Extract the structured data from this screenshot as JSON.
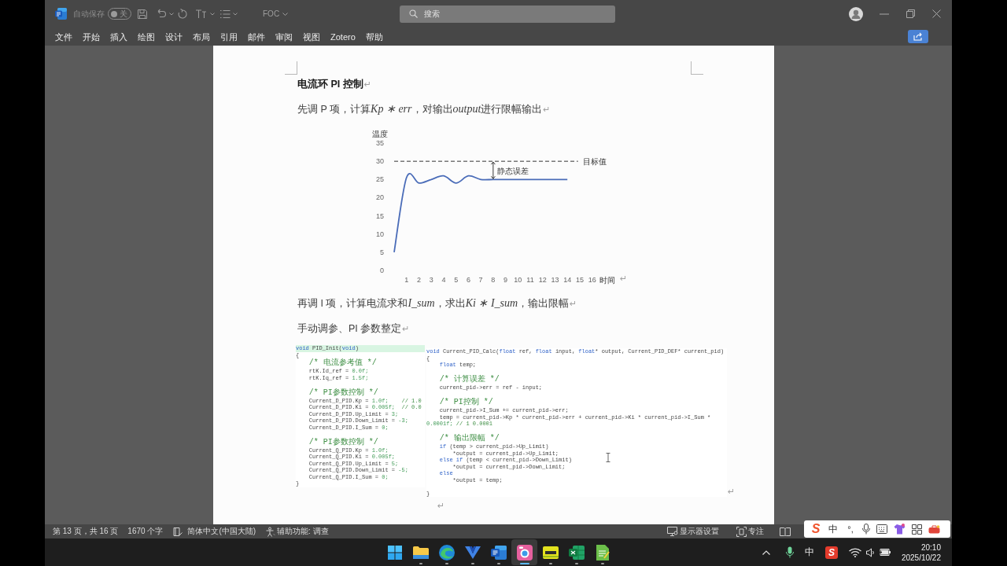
{
  "title_bar": {
    "autosave": {
      "label": "自动保存",
      "on": false,
      "state_label": "关"
    },
    "file_name": "FOC",
    "search": {
      "placeholder": "搜索"
    }
  },
  "ribbon_tabs": [
    "文件",
    "开始",
    "插入",
    "绘图",
    "设计",
    "布局",
    "引用",
    "邮件",
    "审阅",
    "视图",
    "Zotero",
    "帮助"
  ],
  "document": {
    "blocks": [
      {
        "kind": "heading",
        "text": "电流环 PI 控制",
        "mark": "↵"
      },
      {
        "kind": "paragraph",
        "parts": [
          {
            "kind": "text",
            "text": "先调 P 项，计算"
          },
          {
            "kind": "math",
            "text": "Kp ∗ err"
          },
          {
            "kind": "text",
            "text": "，对输出"
          },
          {
            "kind": "math",
            "text": "output"
          },
          {
            "kind": "text",
            "text": "进行限幅输出"
          }
        ],
        "mark": "↵"
      },
      {
        "kind": "chart",
        "mark": "↵",
        "chart_data": {
          "type": "line",
          "ylabel": "温度",
          "xlabel": "时间",
          "x": [
            0,
            1,
            2,
            3,
            4,
            5,
            6,
            7,
            8,
            9,
            10,
            11,
            12,
            13,
            14
          ],
          "values": [
            5,
            25.5,
            24,
            25,
            26,
            24,
            26,
            25,
            25,
            25,
            25,
            25,
            25,
            25,
            25
          ],
          "color": "#4a6cb8",
          "xlim": [
            0,
            16
          ],
          "ylim": [
            0,
            35
          ],
          "xticks": [
            1,
            2,
            3,
            4,
            5,
            6,
            7,
            8,
            9,
            10,
            11,
            12,
            13,
            14,
            15,
            16
          ],
          "yticks": [
            0,
            5,
            10,
            15,
            20,
            25,
            30,
            35
          ],
          "ref_lines": [
            {
              "axis": "y",
              "value": 30,
              "label": "目标值",
              "color": "#333333",
              "line_style": "dashed"
            }
          ],
          "annotations": [
            "静态误差"
          ]
        }
      },
      {
        "kind": "paragraph",
        "parts": [
          {
            "kind": "text",
            "text": "再调 I 项，计算电流求和"
          },
          {
            "kind": "math",
            "text": "I_sum"
          },
          {
            "kind": "text",
            "text": "，求出"
          },
          {
            "kind": "math",
            "text": "Ki ∗ I_sum"
          },
          {
            "kind": "text",
            "text": "，输出限幅"
          }
        ],
        "mark": "↵"
      },
      {
        "kind": "paragraph",
        "parts": [
          {
            "kind": "text",
            "text": "手动调参、PI 参数整定"
          }
        ],
        "mark": "↵"
      },
      {
        "kind": "code_images",
        "mark": "↵",
        "panes": [
          {
            "lines": [
              {
                "kind": "code",
                "highlighted": true,
                "parts": [
                  {
                    "kind": "keyword",
                    "text": "void"
                  },
                  {
                    "kind": "plain",
                    "text": " PID_Init("
                  },
                  {
                    "kind": "keyword",
                    "text": "void"
                  },
                  {
                    "kind": "plain",
                    "text": ")"
                  }
                ]
              },
              {
                "kind": "code",
                "highlighted": false,
                "parts": [
                  {
                    "kind": "plain",
                    "text": "{"
                  }
                ]
              },
              {
                "kind": "comment",
                "highlighted": false,
                "parts": [
                  {
                    "kind": "comment",
                    "text": "    /* 电流参考值 */"
                  }
                ]
              },
              {
                "kind": "code",
                "highlighted": false,
                "parts": [
                  {
                    "kind": "plain",
                    "text": "    rtK.Id_ref = "
                  },
                  {
                    "kind": "number",
                    "text": "0.0f;"
                  }
                ]
              },
              {
                "kind": "code",
                "highlighted": false,
                "parts": [
                  {
                    "kind": "plain",
                    "text": "    rtK.Iq_ref = "
                  },
                  {
                    "kind": "number",
                    "text": "1.5f;"
                  }
                ]
              },
              {
                "kind": "blank",
                "highlighted": false
              },
              {
                "kind": "comment",
                "highlighted": false,
                "parts": [
                  {
                    "kind": "comment",
                    "text": "    /* PI参数控制 */"
                  }
                ]
              },
              {
                "kind": "code",
                "highlighted": false,
                "parts": [
                  {
                    "kind": "plain",
                    "text": "    Current_D_PID.Kp = "
                  },
                  {
                    "kind": "number",
                    "text": "1.0f;"
                  },
                  {
                    "kind": "comment",
                    "text": "    // 1.0"
                  }
                ]
              },
              {
                "kind": "code",
                "highlighted": false,
                "parts": [
                  {
                    "kind": "plain",
                    "text": "    Current_D_PID.Ki = "
                  },
                  {
                    "kind": "number",
                    "text": "0.005f;"
                  },
                  {
                    "kind": "comment",
                    "text": "  // 0.0"
                  }
                ]
              },
              {
                "kind": "code",
                "highlighted": false,
                "parts": [
                  {
                    "kind": "plain",
                    "text": "    Current_D_PID.Up_Limit = "
                  },
                  {
                    "kind": "number",
                    "text": "3;"
                  }
                ]
              },
              {
                "kind": "code",
                "highlighted": false,
                "parts": [
                  {
                    "kind": "plain",
                    "text": "    Current_D_PID.Down_Limit = "
                  },
                  {
                    "kind": "number",
                    "text": "-3;"
                  }
                ]
              },
              {
                "kind": "code",
                "highlighted": false,
                "parts": [
                  {
                    "kind": "plain",
                    "text": "    Current_D_PID.I_Sum = "
                  },
                  {
                    "kind": "number",
                    "text": "0;"
                  }
                ]
              },
              {
                "kind": "blank",
                "highlighted": false
              },
              {
                "kind": "comment",
                "highlighted": false,
                "parts": [
                  {
                    "kind": "comment",
                    "text": "    /* PI参数控制 */"
                  }
                ]
              },
              {
                "kind": "code",
                "highlighted": false,
                "parts": [
                  {
                    "kind": "plain",
                    "text": "    Current_Q_PID.Kp = "
                  },
                  {
                    "kind": "number",
                    "text": "1.0f;"
                  }
                ]
              },
              {
                "kind": "code",
                "highlighted": false,
                "parts": [
                  {
                    "kind": "plain",
                    "text": "    Current_Q_PID.Ki = "
                  },
                  {
                    "kind": "number",
                    "text": "0.005f;"
                  }
                ]
              },
              {
                "kind": "code",
                "highlighted": false,
                "parts": [
                  {
                    "kind": "plain",
                    "text": "    Current_Q_PID.Up_Limit = "
                  },
                  {
                    "kind": "number",
                    "text": "5;"
                  }
                ]
              },
              {
                "kind": "code",
                "highlighted": false,
                "parts": [
                  {
                    "kind": "plain",
                    "text": "    Current_Q_PID.Down_Limit = "
                  },
                  {
                    "kind": "number",
                    "text": "-5;"
                  }
                ]
              },
              {
                "kind": "code",
                "highlighted": false,
                "parts": [
                  {
                    "kind": "plain",
                    "text": "    Current_Q_PID.I_Sum = "
                  },
                  {
                    "kind": "number",
                    "text": "0;"
                  }
                ]
              },
              {
                "kind": "code",
                "highlighted": false,
                "parts": [
                  {
                    "kind": "plain",
                    "text": "}"
                  }
                ]
              }
            ]
          },
          {
            "lines": [
              {
                "kind": "code",
                "highlighted": false,
                "parts": [
                  {
                    "kind": "keyword",
                    "text": "void"
                  },
                  {
                    "kind": "plain",
                    "text": " Current_PID_Calc("
                  },
                  {
                    "kind": "keyword",
                    "text": "float"
                  },
                  {
                    "kind": "plain",
                    "text": " ref, "
                  },
                  {
                    "kind": "keyword",
                    "text": "float"
                  },
                  {
                    "kind": "plain",
                    "text": " input, "
                  },
                  {
                    "kind": "keyword",
                    "text": "float"
                  },
                  {
                    "kind": "plain",
                    "text": "* output, Current_PID_DEF* current_pid)"
                  }
                ]
              },
              {
                "kind": "code",
                "highlighted": false,
                "parts": [
                  {
                    "kind": "plain",
                    "text": "{"
                  }
                ]
              },
              {
                "kind": "code",
                "highlighted": false,
                "parts": [
                  {
                    "kind": "keyword",
                    "text": "    float"
                  },
                  {
                    "kind": "plain",
                    "text": " temp;"
                  }
                ]
              },
              {
                "kind": "blank",
                "highlighted": false
              },
              {
                "kind": "comment",
                "highlighted": false,
                "parts": [
                  {
                    "kind": "comment",
                    "text": "    /* 计算误差 */"
                  }
                ]
              },
              {
                "kind": "code",
                "highlighted": false,
                "parts": [
                  {
                    "kind": "plain",
                    "text": "    current_pid->err = ref - input;"
                  }
                ]
              },
              {
                "kind": "blank",
                "highlighted": false
              },
              {
                "kind": "comment",
                "highlighted": false,
                "parts": [
                  {
                    "kind": "comment",
                    "text": "    /* PI控制 */"
                  }
                ]
              },
              {
                "kind": "code",
                "highlighted": false,
                "parts": [
                  {
                    "kind": "plain",
                    "text": "    current_pid->I_Sum += current_pid->err;"
                  }
                ]
              },
              {
                "kind": "code",
                "highlighted": false,
                "parts": [
                  {
                    "kind": "plain",
                    "text": "    temp = current_pid->Kp * current_pid->err + current_pid->Ki * current_pid->I_Sum * "
                  },
                  {
                    "kind": "number",
                    "text": "0.0001f;"
                  },
                  {
                    "kind": "comment",
                    "text": " // 1 0.0001"
                  }
                ]
              },
              {
                "kind": "blank",
                "highlighted": false
              },
              {
                "kind": "comment",
                "highlighted": false,
                "parts": [
                  {
                    "kind": "comment",
                    "text": "    /* 输出限幅 */"
                  }
                ]
              },
              {
                "kind": "code",
                "highlighted": false,
                "parts": [
                  {
                    "kind": "keyword",
                    "text": "    if"
                  },
                  {
                    "kind": "plain",
                    "text": " (temp > current_pid->Up_Limit)"
                  }
                ]
              },
              {
                "kind": "code",
                "highlighted": false,
                "parts": [
                  {
                    "kind": "plain",
                    "text": "        *output = current_pid->Up_Limit;"
                  }
                ]
              },
              {
                "kind": "code",
                "highlighted": false,
                "parts": [
                  {
                    "kind": "keyword",
                    "text": "    else if"
                  },
                  {
                    "kind": "plain",
                    "text": " (temp < current_pid->Down_Limit)"
                  }
                ]
              },
              {
                "kind": "code",
                "highlighted": false,
                "parts": [
                  {
                    "kind": "plain",
                    "text": "        *output = current_pid->Down_Limit;"
                  }
                ]
              },
              {
                "kind": "code",
                "highlighted": false,
                "parts": [
                  {
                    "kind": "keyword",
                    "text": "    else"
                  }
                ]
              },
              {
                "kind": "code",
                "highlighted": false,
                "parts": [
                  {
                    "kind": "plain",
                    "text": "        *output = temp;"
                  }
                ]
              },
              {
                "kind": "blank",
                "highlighted": false
              },
              {
                "kind": "code",
                "highlighted": false,
                "parts": [
                  {
                    "kind": "plain",
                    "text": "}"
                  }
                ]
              }
            ]
          }
        ]
      },
      {
        "kind": "empty",
        "mark": "↵"
      }
    ]
  },
  "status_bar": {
    "page": "第 13 页，共 16 页",
    "words": "1670 个字",
    "language": "简体中文(中国大陆)",
    "accessibility": "辅助功能: 调查",
    "display_settings": "显示器设置",
    "focus": "专注"
  },
  "ime_toolbar": {
    "logo": "S",
    "mode": "中",
    "punctuation": "°,"
  },
  "taskbar": {
    "apps": [
      {
        "kind": "start",
        "running": false,
        "selected": false
      },
      {
        "kind": "files",
        "running": true,
        "selected": false
      },
      {
        "kind": "browser",
        "running": true,
        "selected": false
      },
      {
        "kind": "chevron",
        "running": true,
        "selected": false
      },
      {
        "kind": "word",
        "running": true,
        "selected": false
      },
      {
        "kind": "camera",
        "running": true,
        "selected": true
      },
      {
        "kind": "pdf",
        "running": true,
        "selected": false
      },
      {
        "kind": "excel",
        "running": true,
        "selected": false
      },
      {
        "kind": "notes",
        "running": true,
        "selected": false
      }
    ],
    "tray": {
      "ime_mode": "中",
      "ime_logo": "S"
    },
    "time": "20:10",
    "date": "2025/10/22"
  }
}
